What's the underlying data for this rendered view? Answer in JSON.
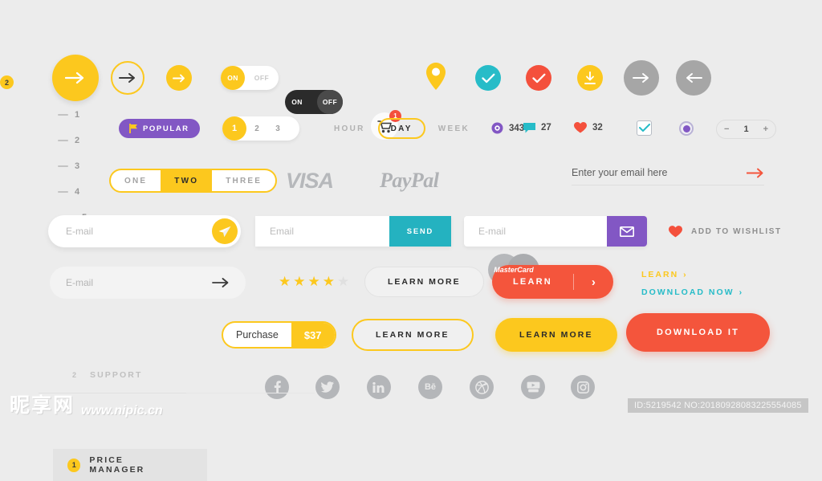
{
  "background": "#ececec",
  "palette": {
    "yellow": "#fcc81e",
    "red": "#f4553c",
    "teal": "#27bcc8",
    "purple": "#8257c4",
    "grey": "#a6a6a6",
    "dark": "#2b2b2b"
  },
  "row1": {
    "arrow_big": "arrow-right-icon",
    "arrow_outline": "arrow-right-icon",
    "arrow_small": "arrow-right-icon",
    "toggle_light": {
      "on": "ON",
      "off": "OFF",
      "state": "on"
    },
    "toggle_dark": {
      "on": "ON",
      "off": "OFF",
      "state": "on"
    },
    "cart": {
      "icon": "shopping-cart-icon",
      "badge": "1"
    },
    "pin": "map-pin-icon",
    "check_teal": "check-icon",
    "check_red": "check-icon",
    "download": "download-icon",
    "arrow_grey_right": "arrow-right-icon",
    "arrow_grey_left": "arrow-left-icon",
    "badge_yellow": "2"
  },
  "steps": [
    {
      "num": "1",
      "active": false
    },
    {
      "num": "2",
      "active": false
    },
    {
      "num": "3",
      "active": false
    },
    {
      "num": "4",
      "active": false
    },
    {
      "num": "5",
      "active": true
    }
  ],
  "popular_badge": {
    "label": "POPULAR",
    "icon": "flag-icon"
  },
  "pager": {
    "items": [
      "1",
      "2",
      "3"
    ],
    "selected": "1"
  },
  "time_segment": {
    "items": [
      "HOUR",
      "DAY",
      "WEEK"
    ],
    "selected": "DAY"
  },
  "stats": {
    "views": {
      "icon": "eye-icon",
      "value": "343"
    },
    "comments": {
      "icon": "comment-icon",
      "value": "27"
    },
    "likes": {
      "icon": "heart-icon",
      "value": "32"
    }
  },
  "checkbox": {
    "icon": "checkbox-checked-icon",
    "checked": true
  },
  "radio": {
    "icon": "radio-selected-icon",
    "checked": true
  },
  "quantity_stepper": {
    "minus": "−",
    "value": "1",
    "plus": "+"
  },
  "segment3": {
    "items": [
      "ONE",
      "TWO",
      "THREE"
    ],
    "selected": "TWO"
  },
  "payment_logos": {
    "visa": "VISA",
    "paypal": "PayPal",
    "mastercard": "MasterCard"
  },
  "email_underline": {
    "placeholder": "Enter your email here",
    "submit_icon": "arrow-right-icon"
  },
  "email_rounded": {
    "placeholder": "E-mail",
    "submit_icon": "paper-plane-icon"
  },
  "email_send": {
    "placeholder": "Email",
    "button_label": "SEND"
  },
  "email_purple": {
    "placeholder": "E-mail",
    "submit_icon": "envelope-icon"
  },
  "wishlist": {
    "icon": "heart-icon",
    "label": "ADD TO WISHLIST"
  },
  "email_flat": {
    "placeholder": "E-mail",
    "submit_icon": "arrow-right-icon"
  },
  "rating": {
    "filled": 4,
    "total": 5,
    "glyph": "★"
  },
  "learn_more_ghost": "LEARN MORE",
  "learn_red": {
    "label": "LEARN",
    "chevron": "›"
  },
  "links": [
    {
      "label": "LEARN",
      "chevron": "›",
      "color": "yellow"
    },
    {
      "label": "DOWNLOAD NOW",
      "chevron": "›",
      "color": "teal"
    }
  ],
  "menu": [
    {
      "num": "1",
      "label": "PRICE MANAGER",
      "active": true
    },
    {
      "num": "2",
      "label": "SUPPORT",
      "active": false
    }
  ],
  "purchase": {
    "label": "Purchase",
    "price": "$37"
  },
  "learn_more_outline": "LEARN MORE",
  "learn_more_filled": "LEARN MORE",
  "download_it": "DOWNLOAD IT",
  "social": [
    "facebook-icon",
    "twitter-icon",
    "linkedin-icon",
    "behance-icon",
    "dribbble-icon",
    "youtube-icon",
    "instagram-icon"
  ],
  "social_labels": [
    "f",
    "t",
    "in",
    "Bē",
    "d",
    "You Tube",
    "ig"
  ],
  "watermark": {
    "cn": "昵享网",
    "url": "www.nipic.cn"
  },
  "footer_id": "ID:5219542 NO:20180928083225554085"
}
